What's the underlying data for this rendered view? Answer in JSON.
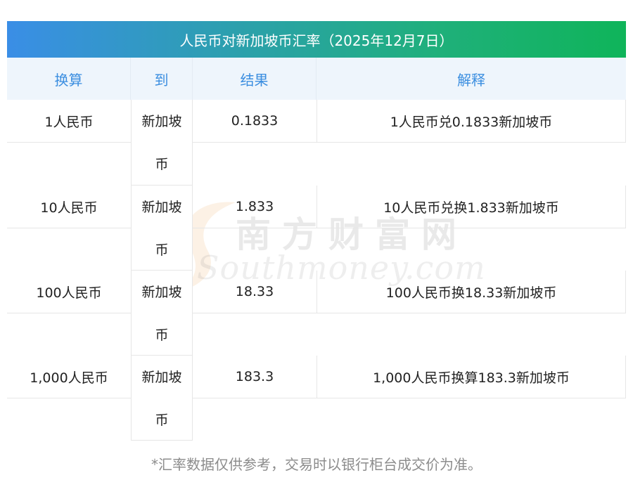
{
  "title": "人民币对新加坡币汇率（2025年12月7日）",
  "headers": {
    "from": "换算",
    "to": "到",
    "result": "结果",
    "explain": "解释"
  },
  "rows": [
    {
      "from": "1人民币",
      "to_line1": "新加坡",
      "to_line2": "币",
      "result": "0.1833",
      "explain": "1人民币兑0.1833新加坡币"
    },
    {
      "from": "10人民币",
      "to_line1": "新加坡",
      "to_line2": "币",
      "result": "1.833",
      "explain": "10人民币兑换1.833新加坡币"
    },
    {
      "from": "100人民币",
      "to_line1": "新加坡",
      "to_line2": "币",
      "result": "18.33",
      "explain": "100人民币换18.33新加坡币"
    },
    {
      "from": "1,000人民币",
      "to_line1": "新加坡",
      "to_line2": "币",
      "result": "183.3",
      "explain": "1,000人民币换算183.3新加坡币"
    }
  ],
  "watermark": {
    "cn": "南方财富网",
    "en": "Southmoney.com"
  },
  "footnote": "*汇率数据仅供参考，交易时以银行柜台成交价为准。",
  "colors": {
    "title_gradient_start": "#3a8ee6",
    "title_gradient_end": "#0fb45a",
    "header_bg": "#eef5fc",
    "header_text": "#3b8ee0"
  }
}
